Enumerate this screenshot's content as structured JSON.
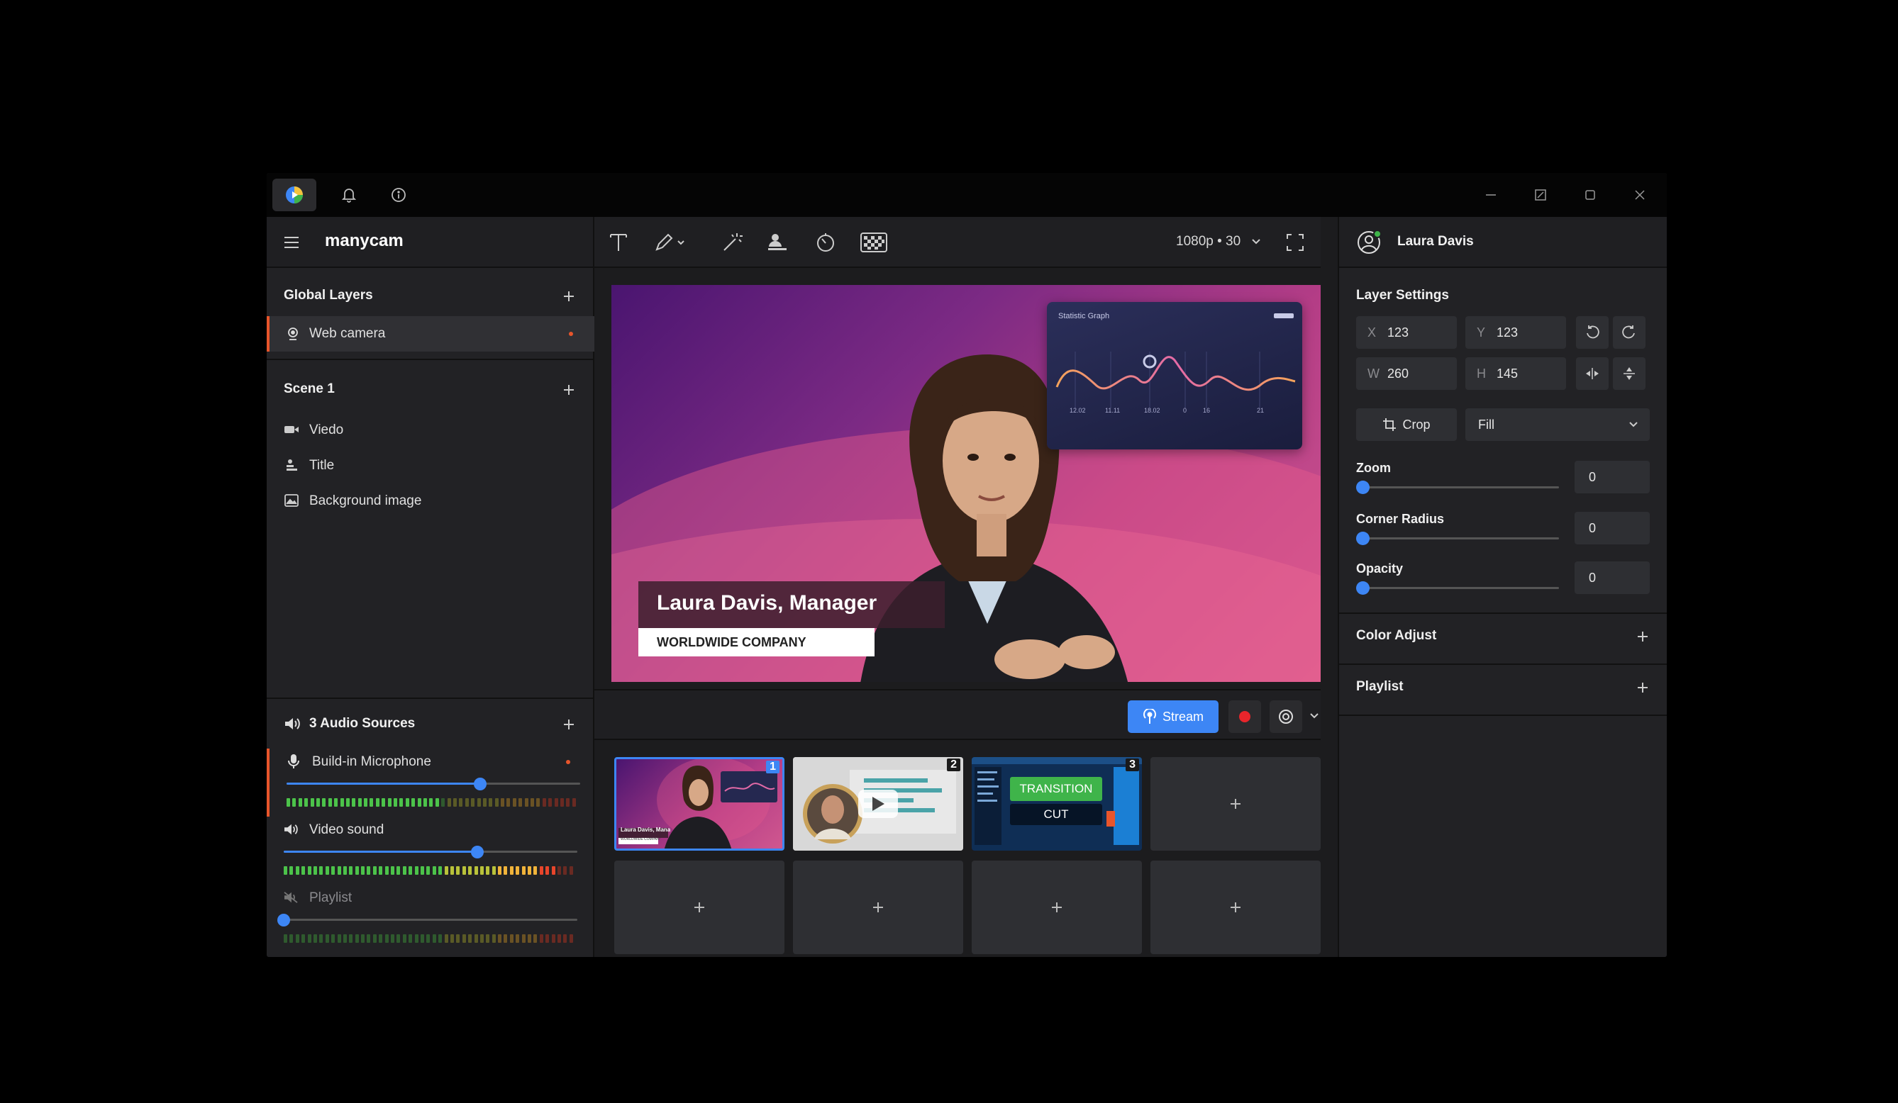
{
  "window": {
    "brand": "manycam",
    "accent": "#3d86f5",
    "record_color": "#e8252b",
    "active_marker": "#e8552b"
  },
  "left": {
    "global_layers_title": "Global Layers",
    "global_layers": [
      {
        "label": "Web camera",
        "icon": "webcam-icon",
        "active": true
      }
    ],
    "scene_title": "Scene 1",
    "scene_layers": [
      {
        "label": "Viedo",
        "icon": "video-camera-icon"
      },
      {
        "label": "Title",
        "icon": "title-layer-icon"
      },
      {
        "label": "Background image",
        "icon": "image-icon"
      }
    ],
    "audio_title": "3 Audio Sources",
    "audio_sources": [
      {
        "label": "Build-in Microphone",
        "icon": "microphone-icon",
        "volume": 0.66,
        "level": 0.52,
        "active": true
      },
      {
        "label": "Video sound",
        "icon": "speaker-icon",
        "volume": 0.66,
        "level": 0.93,
        "active": false
      },
      {
        "label": "Playlist",
        "icon": "speaker-muted-icon",
        "volume": 0.0,
        "level": 0.0,
        "active": false
      }
    ]
  },
  "toolbar": {
    "tools": [
      "text-icon",
      "pen-icon",
      "magic-wand-icon",
      "lower-third-icon",
      "timer-icon",
      "chroma-key-icon"
    ],
    "resolution": "1080p • 30"
  },
  "preview": {
    "name_line": "Laura Davis, Manager",
    "company_line": "WORLDWIDE COMPANY",
    "graph_title": "Statistic Graph",
    "graph_labels": [
      "12.02",
      "11.11",
      "18.02",
      "0",
      "16",
      "21"
    ]
  },
  "controls": {
    "stream_label": "Stream"
  },
  "scenes": [
    {
      "number": "1",
      "kind": "camera",
      "active": true,
      "mini_name": "Laura Davis, Manager",
      "mini_company": "WORLDWIDE COMPANY"
    },
    {
      "number": "2",
      "kind": "video"
    },
    {
      "number": "3",
      "kind": "desktop",
      "transition_label": "TRANSITION",
      "cut_label": "CUT"
    }
  ],
  "right": {
    "user_name": "Laura Davis",
    "layer_settings_title": "Layer Settings",
    "x_key": "X",
    "x_value": "123",
    "y_key": "Y",
    "y_value": "123",
    "w_key": "W",
    "w_value": "260",
    "h_key": "H",
    "h_value": "145",
    "crop_label": "Crop",
    "fill_option": "Fill",
    "zoom_label": "Zoom",
    "zoom_value": "0",
    "radius_label": "Corner Radius",
    "radius_value": "0",
    "opacity_label": "Opacity",
    "opacity_value": "0",
    "color_adjust_title": "Color Adjust",
    "playlist_title": "Playlist"
  }
}
